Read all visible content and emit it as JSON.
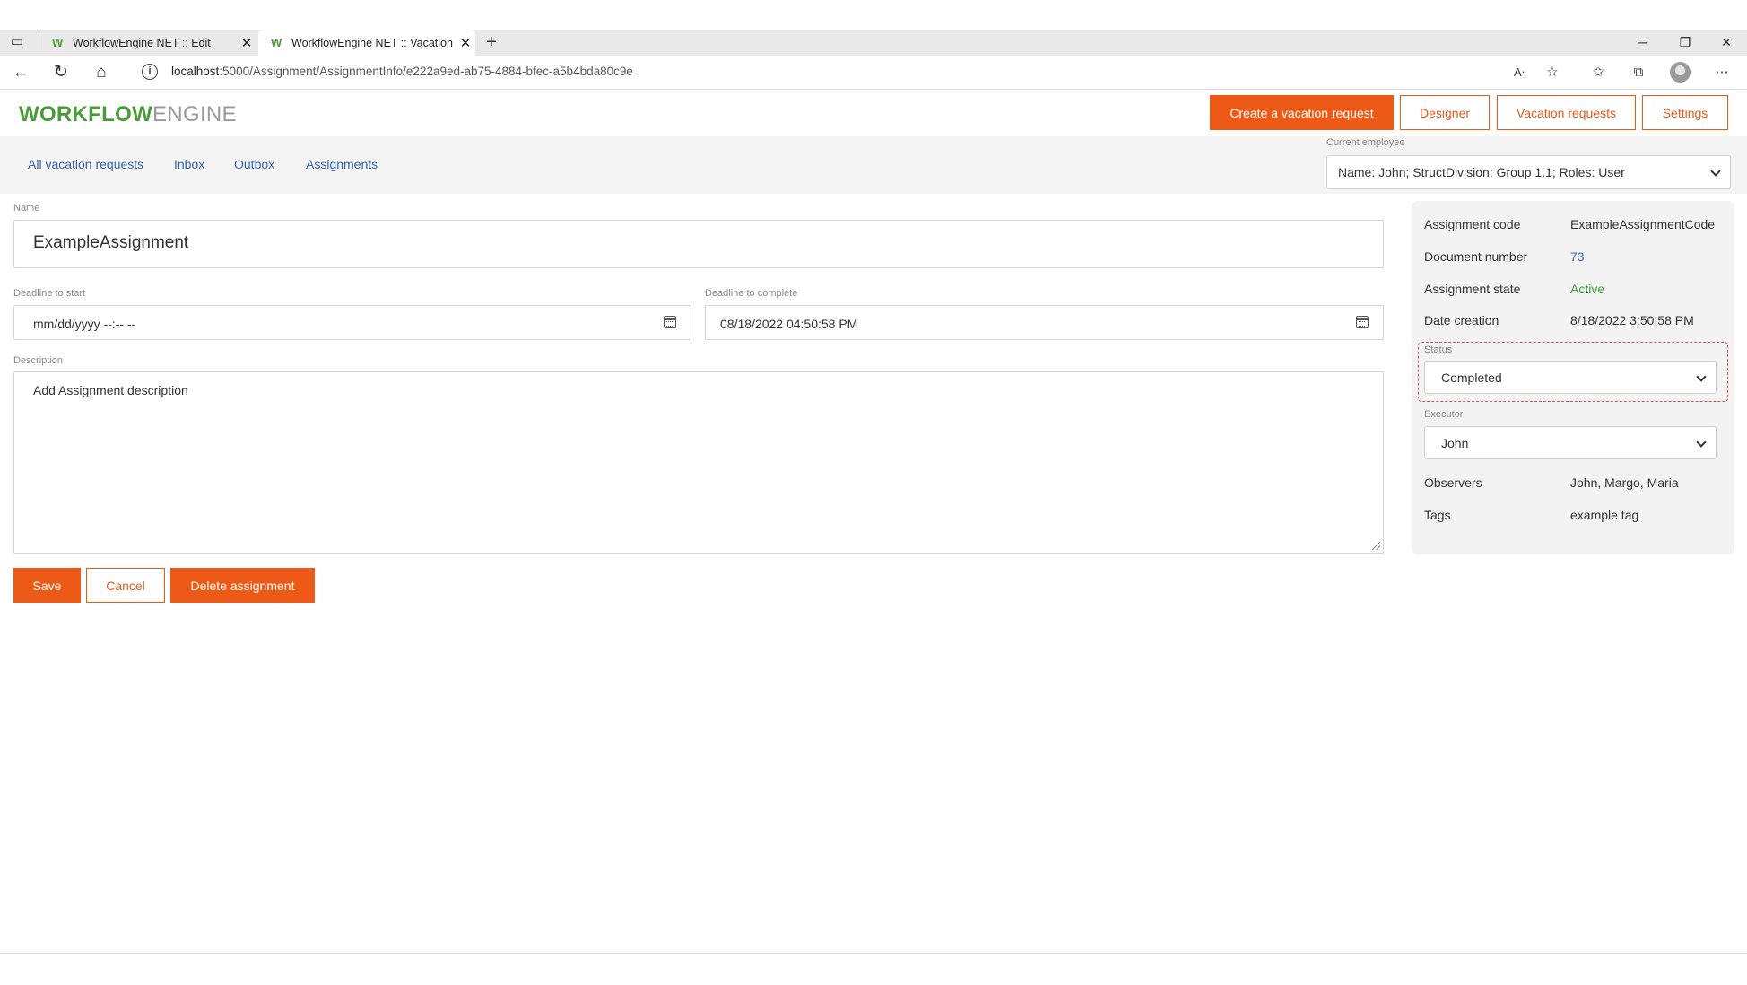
{
  "browser": {
    "tabs": [
      {
        "title": "WorkflowEngine NET :: Edit",
        "active": false
      },
      {
        "title": "WorkflowEngine NET :: Vacation",
        "active": true
      }
    ],
    "url_host": "localhost",
    "url_rest": ":5000/Assignment/AssignmentInfo/e222a9ed-ab75-4884-bfec-a5b4bda80c9e",
    "new_tab_glyph": "+",
    "close_glyph": "✕"
  },
  "header": {
    "logo_bold": "WORKFLOW",
    "logo_light": "ENGINE",
    "buttons": {
      "create": "Create a vacation request",
      "designer": "Designer",
      "vacation_requests": "Vacation requests",
      "settings": "Settings"
    },
    "brand_color": "#ed5a17"
  },
  "subnav": {
    "links": [
      "All vacation requests",
      "Inbox",
      "Outbox",
      "Assignments"
    ],
    "current_employee_label": "Current employee",
    "current_employee_value": "Name: John; StructDivision: Group 1.1; Roles: User"
  },
  "form": {
    "name_label": "Name",
    "name_value": "ExampleAssignment",
    "deadline_start_label": "Deadline to start",
    "deadline_start_value": "mm/dd/yyyy --:-- --",
    "deadline_complete_label": "Deadline to complete",
    "deadline_complete_value": "08/18/2022 04:50:58 PM",
    "description_label": "Description",
    "description_value": "Add Assignment description",
    "actions": {
      "save": "Save",
      "cancel": "Cancel",
      "delete": "Delete assignment"
    }
  },
  "panel": {
    "assignment_code_label": "Assignment code",
    "assignment_code_value": "ExampleAssignmentCode",
    "document_number_label": "Document number",
    "document_number_value": "73",
    "assignment_state_label": "Assignment state",
    "assignment_state_value": "Active",
    "date_creation_label": "Date creation",
    "date_creation_value": "8/18/2022 3:50:58 PM",
    "status_label": "Status",
    "status_value": "Completed",
    "executor_label": "Executor",
    "executor_value": "John",
    "observers_label": "Observers",
    "observers_value": "John, Margo, Maria",
    "tags_label": "Tags",
    "tags_value": "example tag"
  }
}
